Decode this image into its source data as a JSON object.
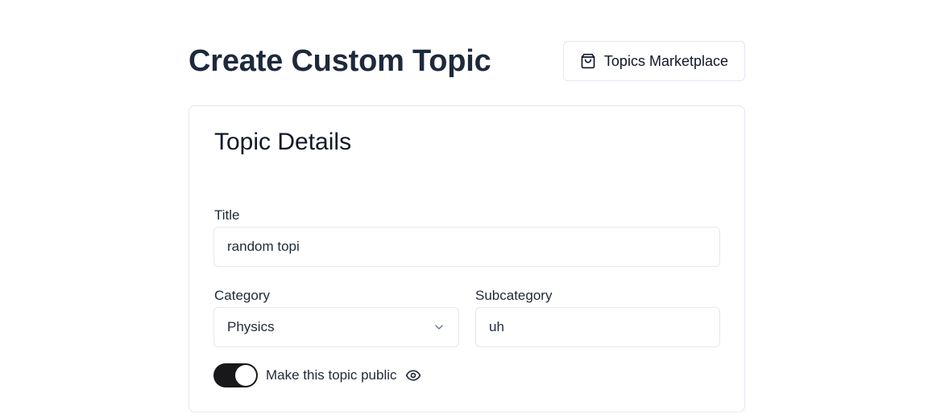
{
  "header": {
    "title": "Create Custom Topic",
    "marketplace_button_label": "Topics Marketplace",
    "marketplace_icon": "shopping-bag-icon"
  },
  "card": {
    "title": "Topic Details",
    "title_field": {
      "label": "Title",
      "value": "random topi"
    },
    "category_field": {
      "label": "Category",
      "selected": "Physics",
      "icon": "chevron-down-icon"
    },
    "subcategory_field": {
      "label": "Subcategory",
      "value": "uh"
    },
    "public_toggle": {
      "label": "Make this topic public",
      "on": true,
      "icon": "eye-icon"
    }
  },
  "colors": {
    "title_text": "#1e293b",
    "border": "#e2e8f0",
    "switch_on": "#18181b"
  }
}
